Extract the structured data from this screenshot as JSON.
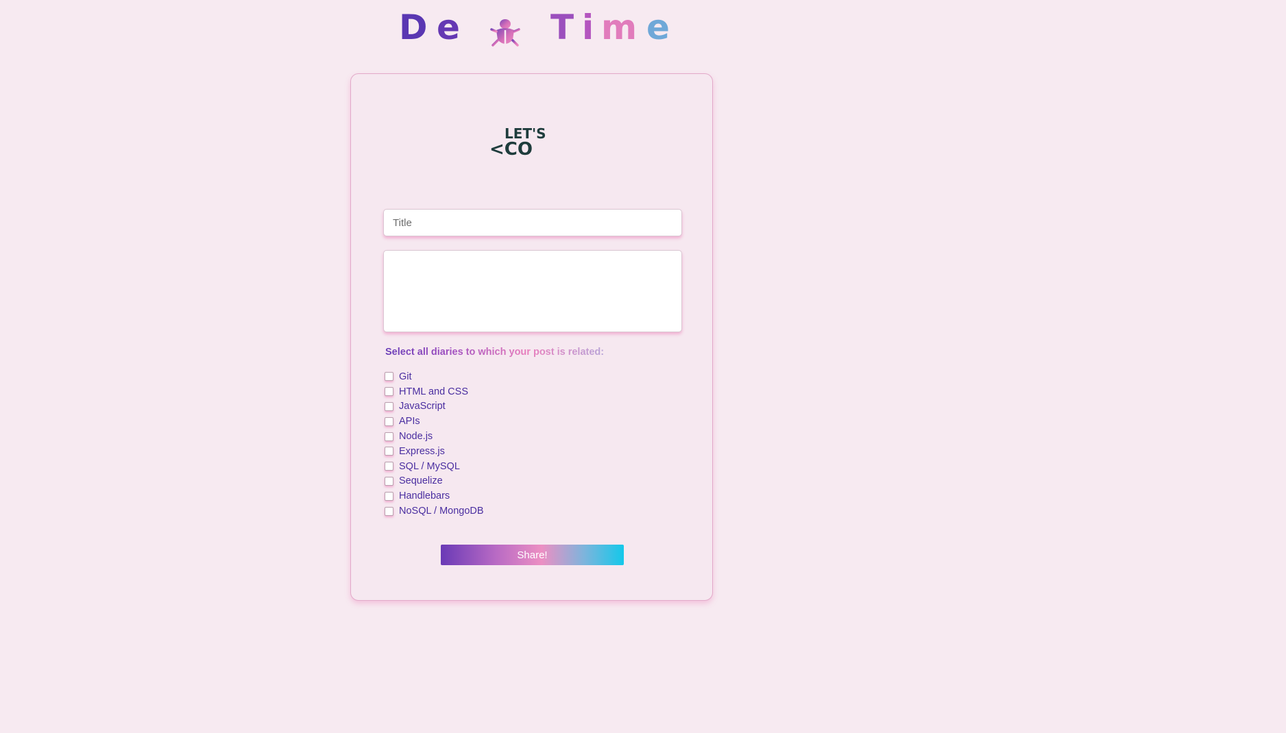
{
  "header": {
    "title_glyphs": [
      {
        "char": "D",
        "color": "#5a37b2"
      },
      {
        "char": "e",
        "color": "#6538b3"
      },
      {
        "char": "T",
        "color": "#9b4fbd"
      },
      {
        "char": "i",
        "color": "#b455bf"
      },
      {
        "char": "m",
        "color": "#e17cbc"
      },
      {
        "char": "e",
        "color": "#6fa8d8"
      }
    ],
    "bug_icon": "bug-icon"
  },
  "logo": {
    "line1": "LET'S",
    "line2": "<CO",
    "color": "#1e3c3c"
  },
  "form": {
    "title_placeholder": "Title",
    "title_value": "",
    "body_value": "",
    "diaries_label": "Select all diaries to which your post is related:",
    "diaries": [
      {
        "label": "Git",
        "checked": false
      },
      {
        "label": "HTML and CSS",
        "checked": false
      },
      {
        "label": "JavaScript",
        "checked": false
      },
      {
        "label": "APIs",
        "checked": false
      },
      {
        "label": "Node.js",
        "checked": false
      },
      {
        "label": "Express.js",
        "checked": false
      },
      {
        "label": "SQL / MySQL",
        "checked": false
      },
      {
        "label": "Sequelize",
        "checked": false
      },
      {
        "label": "Handlebars",
        "checked": false
      },
      {
        "label": "NoSQL / MongoDB",
        "checked": false
      }
    ],
    "share_label": "Share!"
  },
  "colors": {
    "background": "#f7eaf1",
    "card_border": "#e2a9c9",
    "accent_purple": "#5a37b2",
    "accent_pink": "#e97fbd",
    "accent_cyan": "#14c8ea",
    "diary_text": "#4a2ea0"
  }
}
